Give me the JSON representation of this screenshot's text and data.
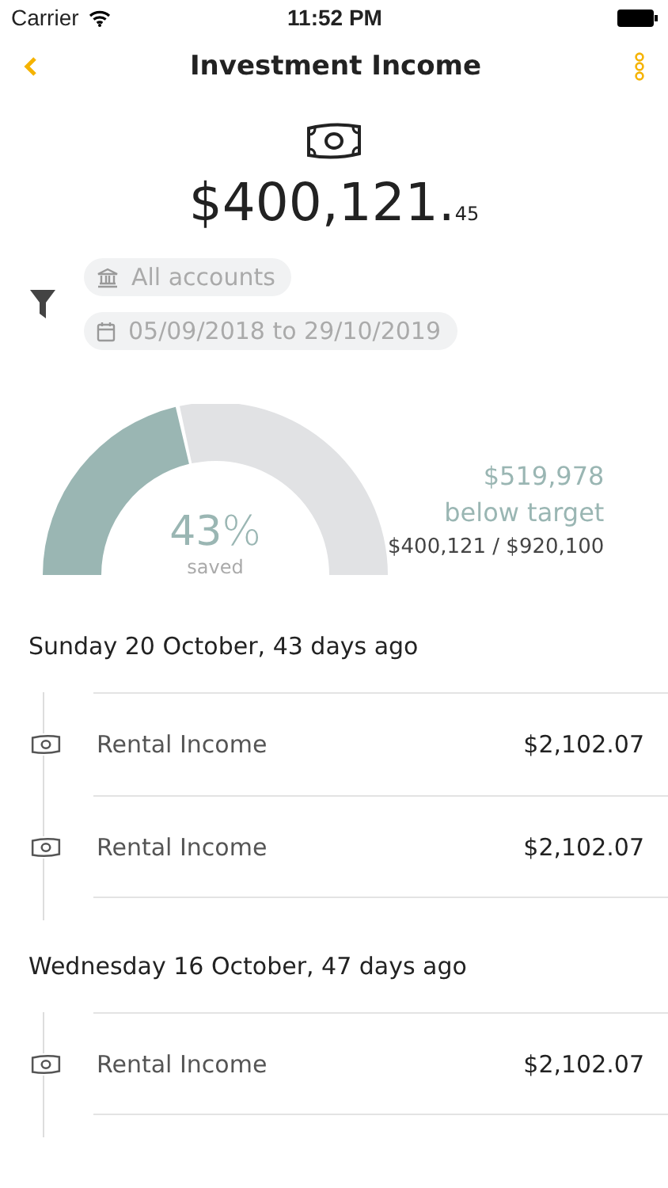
{
  "status_bar": {
    "carrier": "Carrier",
    "time": "11:52 PM"
  },
  "nav": {
    "title": "Investment Income"
  },
  "total": "$400,121.$_{45}$",
  "filters": {
    "account": "All accounts",
    "date_range": "05/09/2018 to 29/10/2019"
  },
  "gauge": {
    "percent": "**43**%",
    "caption": "saved",
    "shortfall": "$519,978",
    "shortfall_label": "below target",
    "progress": "$400,121 / $920,100"
  },
  "groups": [
    {
      "heading": "Sunday 20 October, 43 days ago",
      "rows": [
        {
          "name": "Rental Income",
          "amount": "$2,102.07"
        },
        {
          "name": "Rental Income",
          "amount": "$2,102.07"
        }
      ]
    },
    {
      "heading": "Wednesday 16 October, 47 days ago",
      "rows": [
        {
          "name": "Rental Income",
          "amount": "$2,102.07"
        }
      ]
    }
  ]
}
